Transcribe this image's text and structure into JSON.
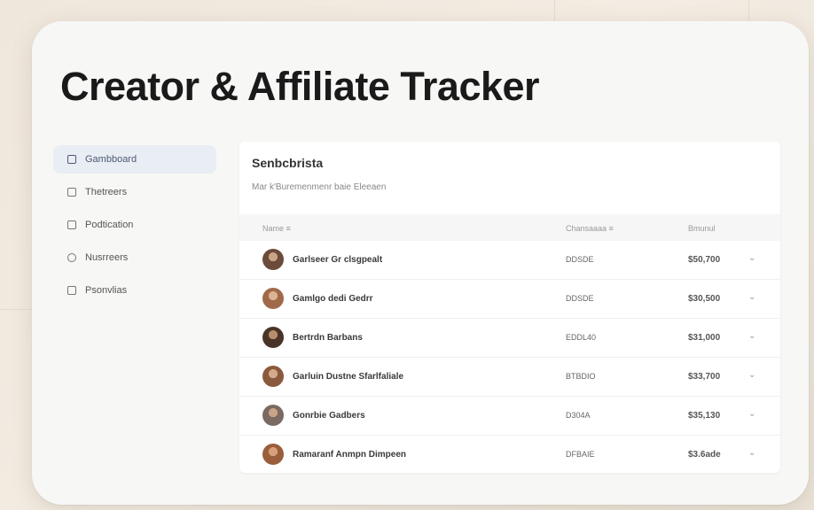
{
  "app": {
    "title": "Creator & Affiliate Tracker"
  },
  "sidebar": {
    "items": [
      {
        "label": "Gambboard",
        "icon": "dashboard-icon",
        "active": true
      },
      {
        "label": "Thetreers",
        "icon": "grid-icon",
        "active": false
      },
      {
        "label": "Podtication",
        "icon": "grid-icon",
        "active": false
      },
      {
        "label": "Nusrreers",
        "icon": "settings-icon",
        "active": false
      },
      {
        "label": "Psonvlias",
        "icon": "square-icon",
        "active": false
      }
    ]
  },
  "panel": {
    "title": "Senbcbrista",
    "subtitle": "Mar k'Buremenmenr baie Eleeaen",
    "columns": [
      "Name ≡",
      "Chansaaaa ≡",
      "Bmunul"
    ],
    "rows": [
      {
        "name": "Garlseer Gr clsgpealt",
        "code": "DDSDE",
        "amount": "$50,700"
      },
      {
        "name": "Gamlgo dedi Gedrr",
        "code": "DDSDE",
        "amount": "$30,500"
      },
      {
        "name": "Bertrdn Barbans",
        "code": "EDDL40",
        "amount": "$31,000"
      },
      {
        "name": "Garluin Dustne Sfarlfaliale",
        "code": "BTBDIO",
        "amount": "$33,700"
      },
      {
        "name": "Gonrbie Gadbers",
        "code": "D304A",
        "amount": "$35,130"
      },
      {
        "name": "Ramaranf Anmpn Dimpeen",
        "code": "DFBAIE",
        "amount": "$3.6ade"
      }
    ]
  },
  "colors": {
    "accent": "#4b5a73",
    "active_bg": "#e9edf4"
  }
}
